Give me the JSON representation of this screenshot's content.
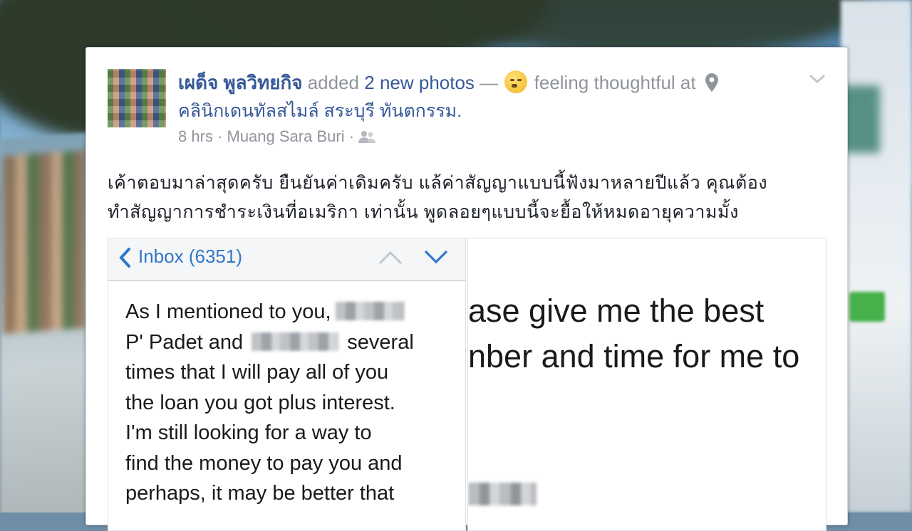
{
  "post": {
    "author": "เผด็จ พูลวิทยกิจ",
    "action_added": "added",
    "photos_link": "2 new photos",
    "dash": "—",
    "feeling": "feeling thoughtful at",
    "location": "คลินิกเดนทัลสไมล์ สระบุรี ทันตกรรม.",
    "time": "8 hrs",
    "place": "Muang Sara Buri",
    "separator": "·",
    "text_line1": "เค้าตอบมาล่าสุดครับ ยืนยันค่าเดิมครับ แล้ค่าสัญญาแบบนี้ฟังมาหลายปีแล้ว คุณต้อง",
    "text_line2": "ทำสัญญาการชำระเงินที่อเมริกา เท่านั้น พูดลอยๆแบบนี้จะยื้อให้หมดอายุความมั้ง"
  },
  "photo1": {
    "inbox_label": "Inbox (6351)",
    "email_lines": [
      "As I mentioned to you,",
      "P' Padet and",
      "several",
      "times that I will pay all of you",
      "the loan you got plus interest.",
      "I'm still looking for a way to",
      "find the money to pay you and",
      "perhaps, it may be better that"
    ]
  },
  "photo2": {
    "line1": "ase give me the best",
    "line2": "nber and time for me to"
  },
  "icons": {
    "emoji": "thoughtful-face-icon",
    "location": "map-pin-icon",
    "audience": "friends-icon",
    "menu": "chevron-down-icon"
  },
  "colors": {
    "link_blue": "#365899",
    "meta_gray": "#90949c",
    "ios_blue": "#2f77c9"
  }
}
